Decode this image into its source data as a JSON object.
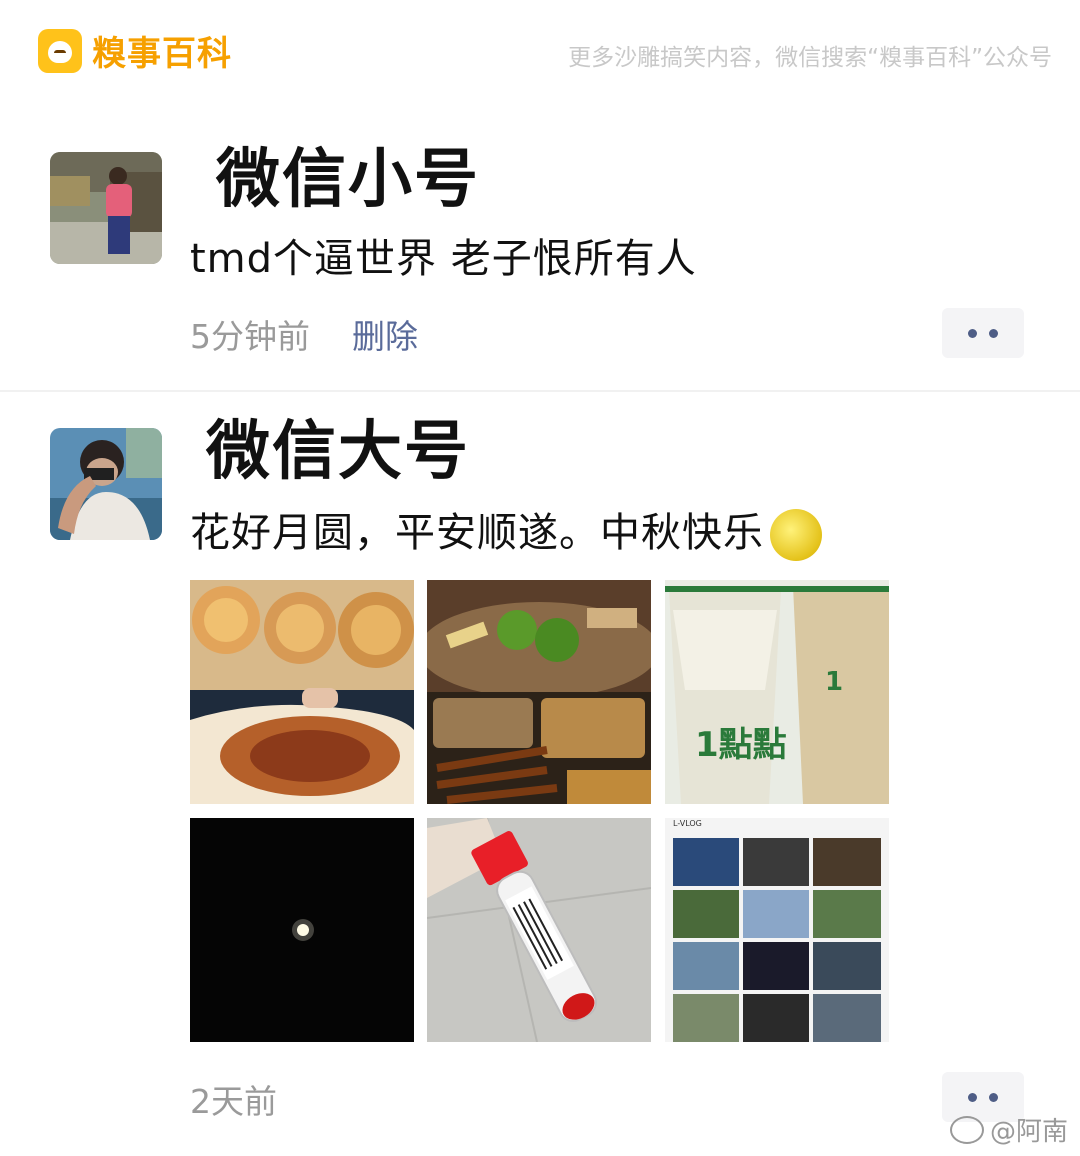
{
  "brand": {
    "name": "糗事百科"
  },
  "promo_text": "更多沙雕搞笑内容，微信搜索“糗事百科”公众号",
  "posts": [
    {
      "name": "微信小号",
      "content": "tmd个逼世界 老子恨所有人",
      "time": "5分钟前",
      "delete": "删除"
    },
    {
      "name": "微信大号",
      "content": "花好月圆，平安顺遂。中秋快乐",
      "time": "2天前"
    }
  ],
  "photo_grid": {
    "items": [
      "mooncakes",
      "barbecue",
      "milk-tea-cups",
      "night-moon",
      "test-tube",
      "vlog-collage"
    ],
    "vlog_label": "L-VLOG"
  },
  "tea_cup_text": "1點點",
  "watermark": "@阿南"
}
